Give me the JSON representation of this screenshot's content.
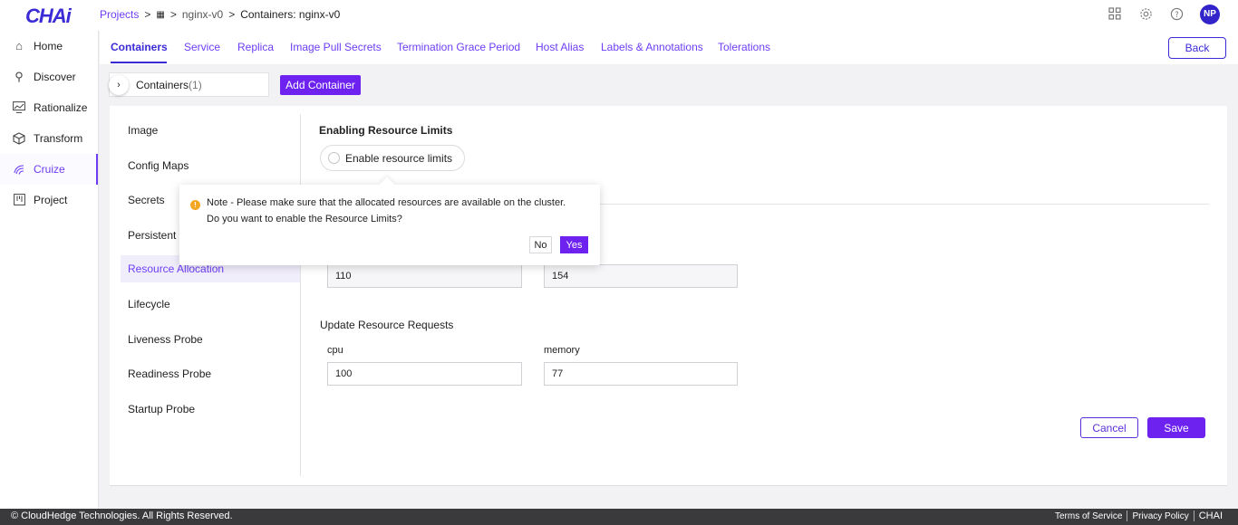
{
  "app": {
    "logo": "CHAi"
  },
  "breadcrumb": {
    "projects": "Projects",
    "sep1": ">",
    "sep2": ">",
    "project": "nginx-v0",
    "sep3": ">",
    "current": "Containers: nginx-v0"
  },
  "header": {
    "avatar_initials": "NP"
  },
  "sidebar": {
    "items": [
      {
        "label": "Home",
        "icon": "home-icon"
      },
      {
        "label": "Discover",
        "icon": "search-icon"
      },
      {
        "label": "Rationalize",
        "icon": "chart-icon"
      },
      {
        "label": "Transform",
        "icon": "cube-icon"
      },
      {
        "label": "Cruize",
        "icon": "fingerprint-icon",
        "active": true
      },
      {
        "label": "Project",
        "icon": "board-icon"
      }
    ]
  },
  "tabs": [
    {
      "label": "Containers",
      "active": true
    },
    {
      "label": "Service"
    },
    {
      "label": "Replica"
    },
    {
      "label": "Image Pull Secrets"
    },
    {
      "label": "Termination Grace Period"
    },
    {
      "label": "Host Alias"
    },
    {
      "label": "Labels & Annotations"
    },
    {
      "label": "Tolerations"
    }
  ],
  "back_label": "Back",
  "containers": {
    "label": "Containers",
    "count": "(1)",
    "add_label": "Add Container"
  },
  "left_menu": [
    "Image",
    "Config Maps",
    "Secrets",
    "Persistent V",
    "Resource Allocation",
    "Lifecycle",
    "Liveness Probe",
    "Readiness Probe",
    "Startup Probe"
  ],
  "resource": {
    "title": "Enabling Resource Limits",
    "enable_label": "Enable resource limits",
    "limits": {
      "cpu_value": "110",
      "memory_value": "154"
    },
    "requests_title": "Update Resource Requests",
    "cpu_label": "cpu",
    "memory_label": "memory",
    "requests": {
      "cpu_value": "100",
      "memory_value": "77"
    }
  },
  "actions": {
    "cancel": "Cancel",
    "save": "Save"
  },
  "popover": {
    "icon": "warning-icon",
    "line1": "Note - Please make sure that the allocated resources are available on the cluster.",
    "line2": "Do you want to enable the Resource Limits?",
    "no": "No",
    "yes": "Yes"
  },
  "footer": {
    "copyright": "© CloudHedge Technologies. All Rights Reserved.",
    "terms": "Terms of Service",
    "privacy": "Privacy Policy",
    "brand": "CHAI"
  },
  "colors": {
    "accent": "#6d22f0",
    "link": "#6d3df5",
    "brand": "#3b2bd6",
    "warning": "#f5a623"
  }
}
